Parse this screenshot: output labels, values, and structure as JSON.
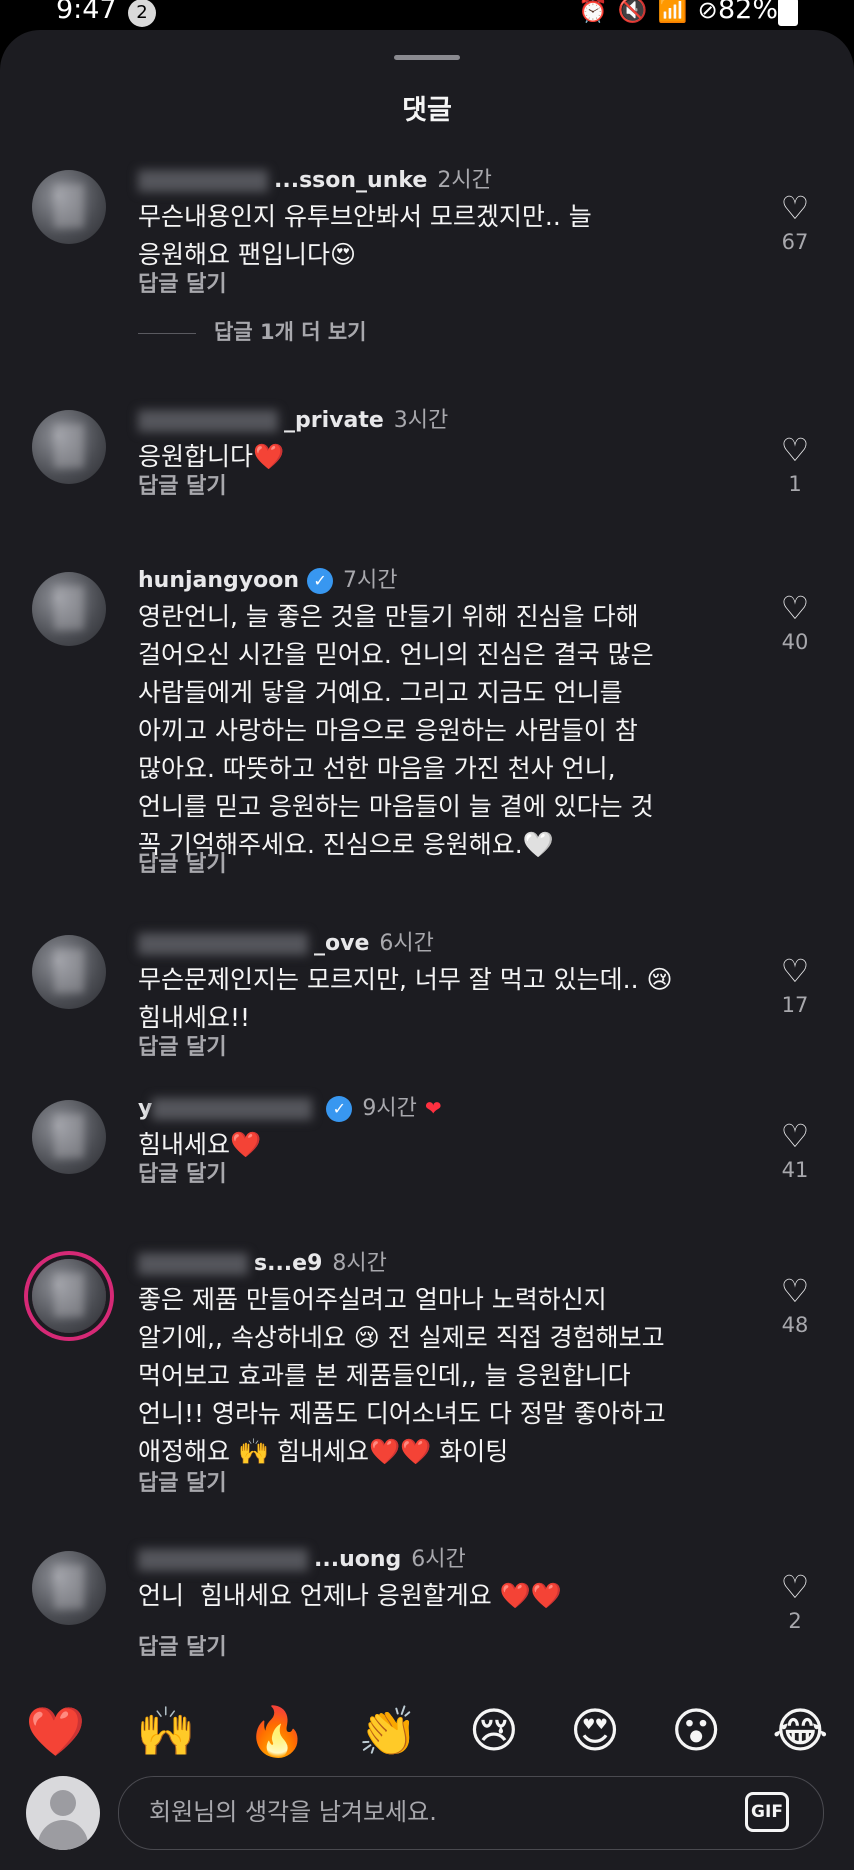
{
  "status_bar": {
    "time": "9:47",
    "notification_count": "2",
    "battery": "82%",
    "icons": [
      "alarm-icon",
      "mute-icon",
      "wifi-icon",
      "dnd-icon",
      "battery-icon"
    ]
  },
  "sheet": {
    "title": "댓글"
  },
  "comments": [
    {
      "username_visible": "...sson_unke",
      "time": "2시간",
      "text": "무슨내용인지 유투브안봐서 모르겠지만.. 늘\n응원해요 팬입니다😍",
      "reply_label": "답글 달기",
      "likes": "67",
      "more_replies": "답글 1개 더 보기"
    },
    {
      "username_visible": "_private",
      "time": "3시간",
      "text": "응원합니다❤️",
      "reply_label": "답글 달기",
      "likes": "1"
    },
    {
      "username_visible": "hunjangyoon",
      "verified": true,
      "time": "7시간",
      "text": "영란언니, 늘 좋은 것을 만들기 위해 진심을 다해\n걸어오신 시간을 믿어요. 언니의 진심은 결국 많은\n사람들에게 닿을 거예요. 그리고 지금도 언니를\n아끼고 사랑하는 마음으로 응원하는 사람들이 참\n많아요. 따뜻하고 선한 마음을 가진 천사 언니,\n언니를 믿고 응원하는 마음들이 늘 곁에 있다는 것\n꼭 기억해주세요. 진심으로 응원해요.🤍",
      "reply_label": "답글 달기",
      "likes": "40"
    },
    {
      "username_visible": "_ove",
      "time": "6시간",
      "text": "무슨문제인지는 모르지만, 너무 잘 먹고 있는데.. 😢\n힘내세요!!",
      "reply_label": "답글 달기",
      "likes": "17"
    },
    {
      "username_visible": "y",
      "verified": true,
      "time": "9시간",
      "creator_liked": true,
      "text": "힘내세요❤️",
      "reply_label": "답글 달기",
      "likes": "41"
    },
    {
      "username_visible": "s...e9",
      "time": "8시간",
      "text": "좋은 제품 만들어주실려고 얼마나 노력하신지\n알기에,, 속상하네요 😢 전 실제로 직접 경험해보고\n먹어보고 효과를 본 제품들인데,, 늘 응원합니다\n언니!! 영라뉴 제품도 디어소녀도 다 정말 좋아하고\n애정해요 🙌 힘내세요❤️❤️ 화이팅",
      "reply_label": "답글 달기",
      "likes": "48"
    },
    {
      "username_visible": "...uong",
      "time": "6시간",
      "text": "언니  힘내세요 언제나 응원할게요 ❤️❤️",
      "reply_label": "답글 달기",
      "likes": "2"
    }
  ],
  "emoji_bar": [
    "❤️",
    "🙌",
    "🔥",
    "👏",
    "😢",
    "😍",
    "😮",
    "😂"
  ],
  "composer": {
    "placeholder": "회원님의 생각을 남겨보세요.",
    "gif_label": "GIF"
  },
  "colors": {
    "sheet_bg": "#1c1c21",
    "accent_blue": "#3897f0",
    "heart_red": "#ff3040",
    "muted_text": "#a8a8ad"
  }
}
